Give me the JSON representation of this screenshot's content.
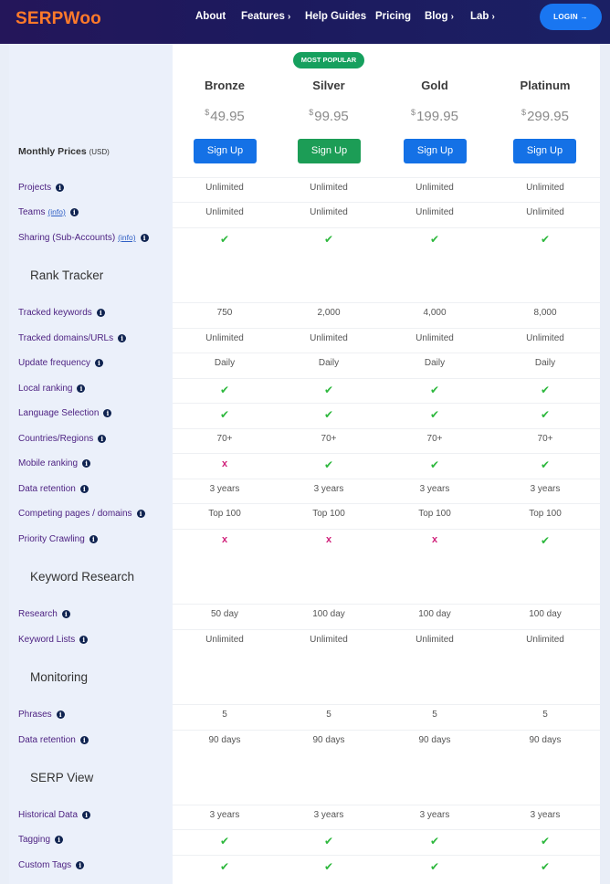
{
  "nav": {
    "logo": "SERPWoo",
    "items": [
      {
        "label": "About",
        "chevron": ""
      },
      {
        "label": "Features",
        "chevron": "›"
      },
      {
        "label": "Help Guides",
        "chevron": ""
      },
      {
        "label": "Pricing",
        "chevron": ""
      },
      {
        "label": "Blog",
        "chevron": "›"
      },
      {
        "label": "Lab",
        "chevron": "›"
      }
    ],
    "login": "LOGIN →"
  },
  "pricing": {
    "badge": "MOST POPULAR",
    "monthly_label": "Monthly Prices",
    "monthly_unit": "(USD)",
    "plans": [
      {
        "name": "Bronze",
        "currency": "$",
        "price": "49.95",
        "signup": "Sign Up"
      },
      {
        "name": "Silver",
        "currency": "$",
        "price": "99.95",
        "signup": "Sign Up"
      },
      {
        "name": "Gold",
        "currency": "$",
        "price": "199.95",
        "signup": "Sign Up"
      },
      {
        "name": "Platinum",
        "currency": "$",
        "price": "299.95",
        "signup": "Sign Up"
      }
    ]
  },
  "icons": {
    "check": "✔",
    "cross": "x",
    "info": "i"
  },
  "colors": {
    "brand": "#ff7a2a",
    "nav_bg": "#1c1a5e",
    "accent_blue": "#1471e6",
    "accent_green": "#1c9d56",
    "check": "#2db83d",
    "cross": "#d0207a",
    "label": "#4b1f80"
  },
  "features": [
    {
      "label": "Projects",
      "info_link": "",
      "values": [
        "Unlimited",
        "Unlimited",
        "Unlimited",
        "Unlimited"
      ]
    },
    {
      "label": "Teams",
      "info_link": "(info)",
      "values": [
        "Unlimited",
        "Unlimited",
        "Unlimited",
        "Unlimited"
      ]
    },
    {
      "label": "Sharing (Sub-Accounts)",
      "info_link": "(info)",
      "values": [
        "✔",
        "✔",
        "✔",
        "✔"
      ]
    },
    {
      "section": "Rank Tracker"
    },
    {
      "label": "Tracked keywords",
      "info_link": "",
      "values": [
        "750",
        "2,000",
        "4,000",
        "8,000"
      ]
    },
    {
      "label": "Tracked domains/URLs",
      "info_link": "",
      "values": [
        "Unlimited",
        "Unlimited",
        "Unlimited",
        "Unlimited"
      ]
    },
    {
      "label": "Update frequency",
      "info_link": "",
      "values": [
        "Daily",
        "Daily",
        "Daily",
        "Daily"
      ]
    },
    {
      "label": "Local ranking",
      "info_link": "",
      "values": [
        "✔",
        "✔",
        "✔",
        "✔"
      ]
    },
    {
      "label": "Language Selection",
      "info_link": "",
      "values": [
        "✔",
        "✔",
        "✔",
        "✔"
      ]
    },
    {
      "label": "Countries/Regions",
      "info_link": "",
      "values": [
        "70+",
        "70+",
        "70+",
        "70+"
      ]
    },
    {
      "label": "Mobile ranking",
      "info_link": "",
      "values": [
        "x",
        "✔",
        "✔",
        "✔"
      ]
    },
    {
      "label": "Data retention",
      "info_link": "",
      "values": [
        "3 years",
        "3 years",
        "3 years",
        "3 years"
      ]
    },
    {
      "label": "Competing pages / domains",
      "info_link": "",
      "values": [
        "Top 100",
        "Top 100",
        "Top 100",
        "Top 100"
      ]
    },
    {
      "label": "Priority Crawling",
      "info_link": "",
      "values": [
        "x",
        "x",
        "x",
        "✔"
      ]
    },
    {
      "section": "Keyword Research"
    },
    {
      "label": "Research",
      "info_link": "",
      "values": [
        "50 day",
        "100 day",
        "100 day",
        "100 day"
      ]
    },
    {
      "label": "Keyword Lists",
      "info_link": "",
      "values": [
        "Unlimited",
        "Unlimited",
        "Unlimited",
        "Unlimited"
      ]
    },
    {
      "section": "Monitoring"
    },
    {
      "label": "Phrases",
      "info_link": "",
      "values": [
        "5",
        "5",
        "5",
        "5"
      ]
    },
    {
      "label": "Data retention",
      "info_link": "",
      "values": [
        "90 days",
        "90 days",
        "90 days",
        "90 days"
      ]
    },
    {
      "section": "SERP View"
    },
    {
      "label": "Historical Data",
      "info_link": "",
      "values": [
        "3 years",
        "3 years",
        "3 years",
        "3 years"
      ]
    },
    {
      "label": "Tagging",
      "info_link": "",
      "values": [
        "✔",
        "✔",
        "✔",
        "✔"
      ]
    },
    {
      "label": "Custom Tags",
      "info_link": "",
      "values": [
        "✔",
        "✔",
        "✔",
        "✔"
      ]
    }
  ]
}
